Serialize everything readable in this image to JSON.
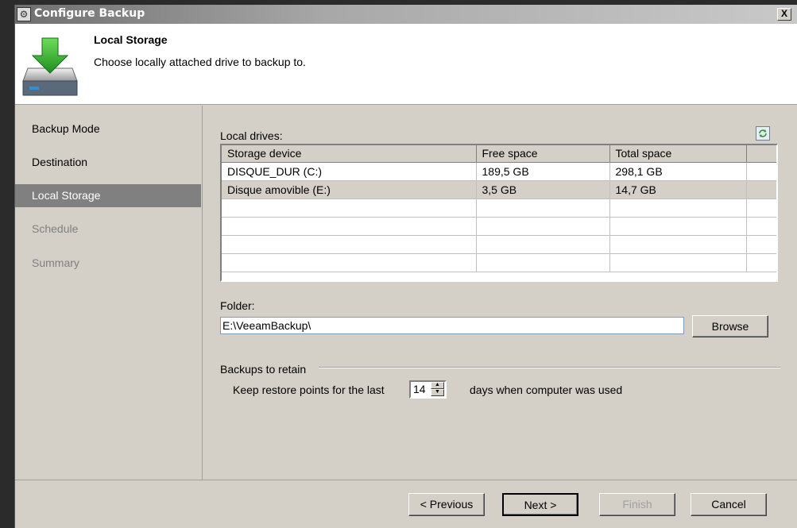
{
  "window": {
    "title": "Configure Backup",
    "close_label": "X"
  },
  "header": {
    "title": "Local Storage",
    "description": "Choose locally attached drive to backup to."
  },
  "sidebar": {
    "items": [
      {
        "label": "Backup Mode",
        "state": "normal"
      },
      {
        "label": "Destination",
        "state": "normal"
      },
      {
        "label": "Local Storage",
        "state": "active"
      },
      {
        "label": "Schedule",
        "state": "disabled"
      },
      {
        "label": "Summary",
        "state": "disabled"
      }
    ]
  },
  "drives": {
    "label": "Local drives:",
    "columns": [
      "Storage device",
      "Free space",
      "Total space"
    ],
    "rows": [
      {
        "device": "DISQUE_DUR (C:)",
        "free": "189,5 GB",
        "total": "298,1 GB"
      },
      {
        "device": "Disque amovible (E:)",
        "free": "3,5 GB",
        "total": "14,7 GB"
      }
    ]
  },
  "folder": {
    "label": "Folder:",
    "value": "E:\\VeeamBackup\\",
    "browse_label": "Browse"
  },
  "retain": {
    "group_label": "Backups to retain",
    "prefix": "Keep restore points for the last",
    "value": "14",
    "suffix": "days when computer was used"
  },
  "footer": {
    "previous": "< Previous",
    "next": "Next >",
    "finish": "Finish",
    "cancel": "Cancel"
  },
  "colors": {
    "active_item": "#808080",
    "dialog_bg": "#d4d0c8",
    "selected_row": "#d4d0c8"
  }
}
